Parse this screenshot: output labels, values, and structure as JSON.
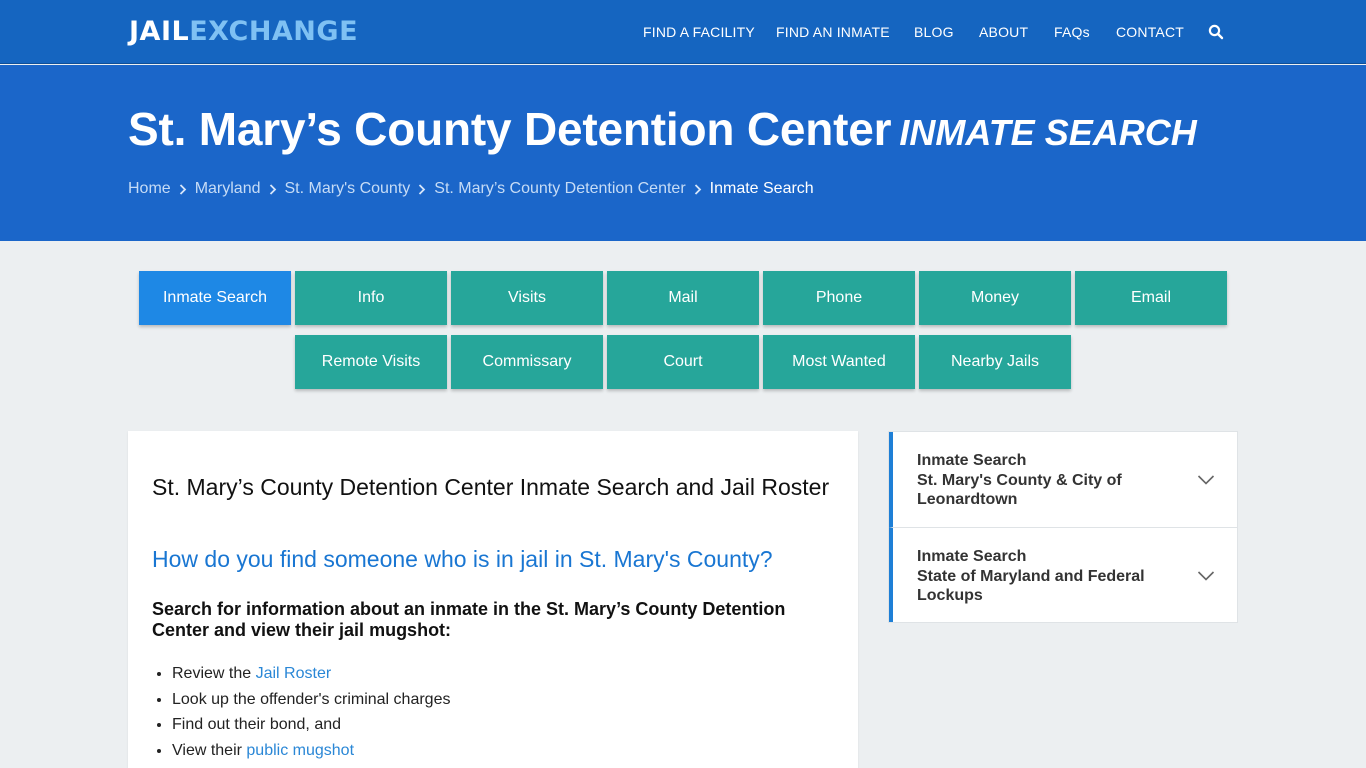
{
  "header": {
    "logo_part1": "JAIL",
    "logo_part2": "EXCHANGE",
    "nav": [
      "FIND A FACILITY",
      "FIND AN INMATE",
      "BLOG",
      "ABOUT",
      "FAQs",
      "CONTACT"
    ],
    "search_icon": "search-icon"
  },
  "hero": {
    "title": "St. Mary’s County Detention Center",
    "subtitle": "INMATE SEARCH",
    "breadcrumbs": [
      "Home",
      "Maryland",
      "St. Mary's County",
      "St. Mary’s County Detention Center"
    ],
    "breadcrumb_current": "Inmate Search"
  },
  "tabs": {
    "row1": [
      "Inmate Search",
      "Info",
      "Visits",
      "Mail",
      "Phone",
      "Money",
      "Email"
    ],
    "row2": [
      "Remote Visits",
      "Commissary",
      "Court",
      "Most Wanted",
      "Nearby Jails"
    ],
    "active": "Inmate Search"
  },
  "main": {
    "heading": "St. Mary’s County Detention Center Inmate Search and Jail Roster",
    "question": "How do you find someone who is in jail in St. Mary's County?",
    "intro": "Search for information about an inmate in the St. Mary’s County Detention Center and view their jail mugshot:",
    "list": [
      {
        "pre": "Review the ",
        "link": "Jail Roster"
      },
      {
        "pre": "Look up the offender's criminal charges",
        "link": ""
      },
      {
        "pre": "Find out their bond, and",
        "link": ""
      },
      {
        "pre": "View their ",
        "link": "public mugshot"
      }
    ]
  },
  "sidebar": {
    "items": [
      {
        "line1": "Inmate Search",
        "line2": "St. Mary's County & City of Leonardtown"
      },
      {
        "line1": "Inmate Search",
        "line2": "State of Maryland and Federal Lockups"
      }
    ]
  },
  "colors": {
    "header": "#1565c0",
    "hero": "#1b66c9",
    "tab": "#26a69a",
    "tab_active": "#1e88e5",
    "link": "#2a87d6",
    "question": "#1976d2"
  }
}
